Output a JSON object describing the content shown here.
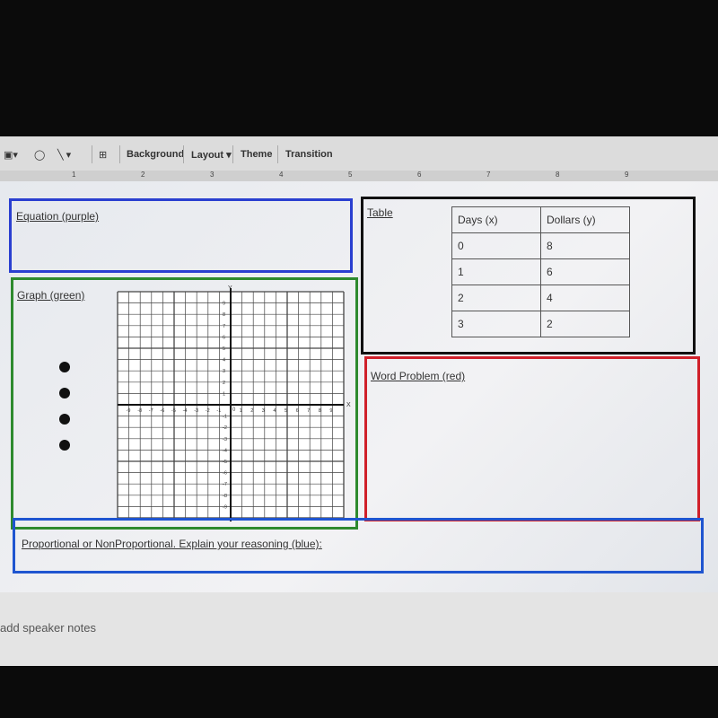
{
  "toolbar": {
    "background": "Background",
    "layout": "Layout ▾",
    "theme": "Theme",
    "transition": "Transition"
  },
  "ruler": [
    "1",
    "2",
    "3",
    "4",
    "5",
    "6",
    "7",
    "8",
    "9"
  ],
  "slide": {
    "equation_label": "Equation (purple)",
    "table_label": "Table",
    "graph_label": "Graph (green)",
    "word_problem_label": "Word Problem (red)",
    "proportional_label": "Proportional or NonProportional. Explain your reasoning (blue):",
    "table": {
      "headers": [
        "Days (x)",
        "Dollars (y)"
      ],
      "rows": [
        [
          "0",
          "8"
        ],
        [
          "1",
          "6"
        ],
        [
          "2",
          "4"
        ],
        [
          "3",
          "2"
        ]
      ]
    },
    "graph": {
      "x_axis_label": "X",
      "y_axis_label": "Y",
      "origin_label": "0",
      "range": [
        -10,
        10
      ],
      "ticks": [
        -9,
        -8,
        -7,
        -6,
        -5,
        -4,
        -3,
        -2,
        -1,
        1,
        2,
        3,
        4,
        5,
        6,
        7,
        8,
        9
      ]
    },
    "bullet_count": 4
  },
  "notes_placeholder": "add speaker notes",
  "colors": {
    "equation": "#2a3fd0",
    "table": "#111111",
    "graph": "#2e8a2e",
    "word_problem": "#d0202a",
    "proportional": "#1f55d0"
  }
}
